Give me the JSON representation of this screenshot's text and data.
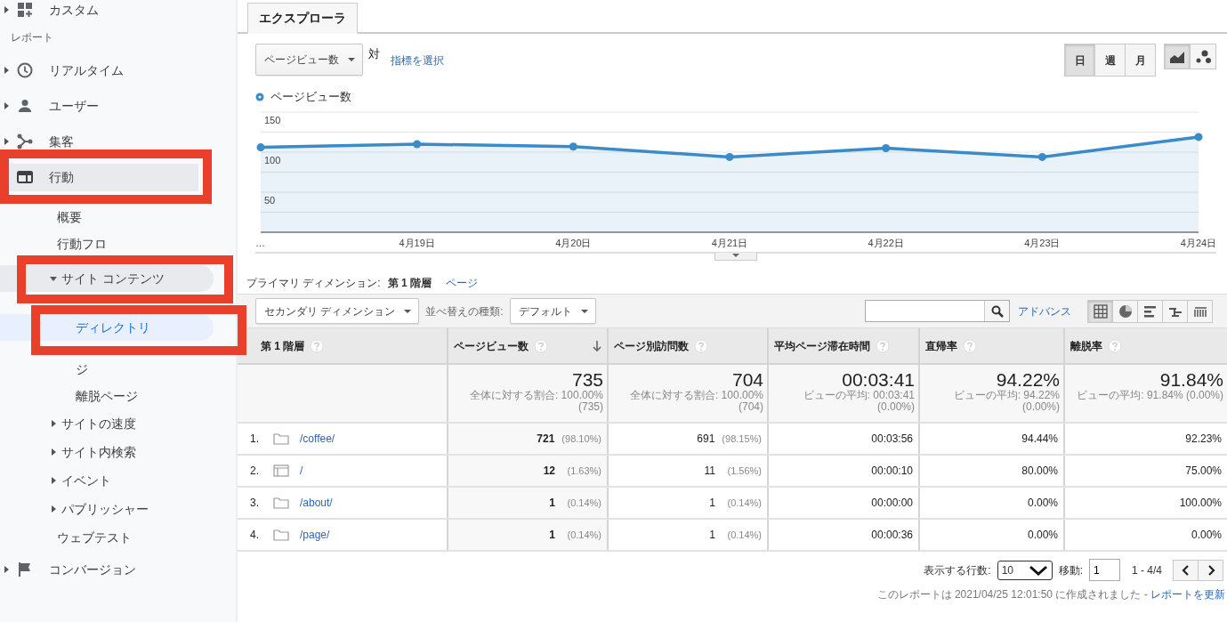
{
  "sidebar": {
    "top_item": {
      "label": "カスタム",
      "expanded": false
    },
    "reports_heading": "レポート",
    "items": [
      {
        "label": "リアルタイム",
        "expanded": false,
        "selected": false,
        "highlighted": false
      },
      {
        "label": "ユーザー",
        "expanded": false,
        "selected": false,
        "highlighted": false
      },
      {
        "label": "集客",
        "expanded": false,
        "selected": false,
        "highlighted": false
      },
      {
        "label": "行動",
        "expanded": true,
        "selected": true,
        "highlighted": true,
        "children": [
          {
            "label": "概要",
            "selected": false,
            "highlighted": false
          },
          {
            "label": "行動フロ",
            "selected": false,
            "highlighted": false
          },
          {
            "label": "サイト コンテンツ",
            "expanded": true,
            "selected": true,
            "highlighted": true,
            "children": [
              {
                "label": "ディレクトリ",
                "selected": true,
                "highlighted": true
              },
              {
                "label": "ジ",
                "selected": false,
                "highlighted": false
              },
              {
                "label": "離脱ページ",
                "selected": false,
                "highlighted": false
              }
            ]
          },
          {
            "label": "サイトの速度",
            "expanded": false,
            "selected": false,
            "highlighted": false
          },
          {
            "label": "サイト内検索",
            "expanded": false,
            "selected": false,
            "highlighted": false
          },
          {
            "label": "イベント",
            "expanded": false,
            "selected": false,
            "highlighted": false
          },
          {
            "label": "パブリッシャー",
            "expanded": false,
            "selected": false,
            "highlighted": false
          },
          {
            "label": "ウェブテスト",
            "selected": false,
            "highlighted": false
          }
        ]
      },
      {
        "label": "コンバージョン",
        "expanded": false,
        "selected": false,
        "highlighted": false
      }
    ]
  },
  "tabs": [
    {
      "label": "エクスプローラ",
      "selected": true
    }
  ],
  "metric_select": {
    "value": "ページビュー数"
  },
  "versus": "対",
  "choose_metric_link": "指標を選択",
  "period_buttons": [
    {
      "label": "日",
      "selected": true
    },
    {
      "label": "週",
      "selected": false
    },
    {
      "label": "月",
      "selected": false
    }
  ],
  "chart_type_buttons": [
    {
      "kind": "line",
      "selected": true
    },
    {
      "kind": "motion",
      "selected": false
    }
  ],
  "chart": {
    "chart_data": {
      "type": "area",
      "categories": [
        "…",
        "4月19日",
        "4月20日",
        "4月21日",
        "4月22日",
        "4月23日",
        "4月24日"
      ],
      "series": [
        {
          "name": "ページビュー数",
          "color": "#3b8bc8",
          "values": [
            106,
            110,
            107,
            94,
            105,
            94,
            119
          ]
        }
      ],
      "ylim": [
        0,
        150
      ],
      "yticks": [
        50,
        100,
        150
      ]
    }
  },
  "primary_dimension": {
    "label": "プライマリ ディメンション:",
    "options": [
      {
        "label": "第 1 階層",
        "selected": true
      },
      {
        "label": "ページ",
        "selected": false
      }
    ]
  },
  "toolbar": {
    "secondary_dimension": "セカンダリ ディメンション",
    "sort_label": "並べ替えの種類:",
    "sort_value": "デフォルト",
    "advanced_link": "アドバンス",
    "views": [
      {
        "kind": "table",
        "selected": true
      },
      {
        "kind": "pie",
        "selected": false
      },
      {
        "kind": "bars",
        "selected": false
      },
      {
        "kind": "comparison",
        "selected": false
      },
      {
        "kind": "pivot",
        "selected": false
      }
    ]
  },
  "table": {
    "columns": [
      {
        "label": "第 1 階層",
        "sorted": false
      },
      {
        "label": "ページビュー数",
        "sorted": true
      },
      {
        "label": "ページ別訪問数",
        "sorted": false
      },
      {
        "label": "平均ページ滞在時間",
        "sorted": false
      },
      {
        "label": "直帰率",
        "sorted": false
      },
      {
        "label": "離脱率",
        "sorted": false
      }
    ],
    "totals": [
      {
        "value": "735",
        "notes": [
          "全体に対する割合: 100.00%",
          "(735)"
        ]
      },
      {
        "value": "704",
        "notes": [
          "全体に対する割合: 100.00%",
          "(704)"
        ]
      },
      {
        "value": "00:03:41",
        "notes": [
          "ビューの平均: 00:03:41",
          "(0.00%)"
        ]
      },
      {
        "value": "94.22%",
        "notes": [
          "ビューの平均: 94.22%",
          "(0.00%)"
        ]
      },
      {
        "value": "91.84%",
        "notes": [
          "ビューの平均: 91.84% (0.00%)"
        ]
      }
    ],
    "rows": [
      {
        "cells": [
          {
            "rank": "1.",
            "kind": "folder",
            "path": "/coffee/"
          },
          {
            "value": "721",
            "share": "(98.10%)"
          },
          {
            "value": "691",
            "share": "(98.15%)"
          },
          {
            "value": "00:03:56"
          },
          {
            "value": "94.44%"
          },
          {
            "value": "92.23%"
          }
        ]
      },
      {
        "cells": [
          {
            "rank": "2.",
            "kind": "page",
            "path": "/"
          },
          {
            "value": "12",
            "share": "(1.63%)"
          },
          {
            "value": "11",
            "share": "(1.56%)"
          },
          {
            "value": "00:00:10"
          },
          {
            "value": "80.00%"
          },
          {
            "value": "75.00%"
          }
        ]
      },
      {
        "cells": [
          {
            "rank": "3.",
            "kind": "folder",
            "path": "/about/"
          },
          {
            "value": "1",
            "share": "(0.14%)"
          },
          {
            "value": "1",
            "share": "(0.14%)"
          },
          {
            "value": "00:00:00"
          },
          {
            "value": "0.00%"
          },
          {
            "value": "100.00%"
          }
        ]
      },
      {
        "cells": [
          {
            "rank": "4.",
            "kind": "folder",
            "path": "/page/"
          },
          {
            "value": "1",
            "share": "(0.14%)"
          },
          {
            "value": "1",
            "share": "(0.14%)"
          },
          {
            "value": "00:00:36"
          },
          {
            "value": "0.00%"
          },
          {
            "value": "0.00%"
          }
        ]
      }
    ]
  },
  "pagination": {
    "rows_label": "表示する行数:",
    "rows_value": "10",
    "goto_label": "移動:",
    "goto_value": "1",
    "range": "1 - 4/4"
  },
  "report_note": {
    "text": "このレポートは 2021/04/25 12:01:50 に作成されました -",
    "link": "レポートを更新"
  }
}
